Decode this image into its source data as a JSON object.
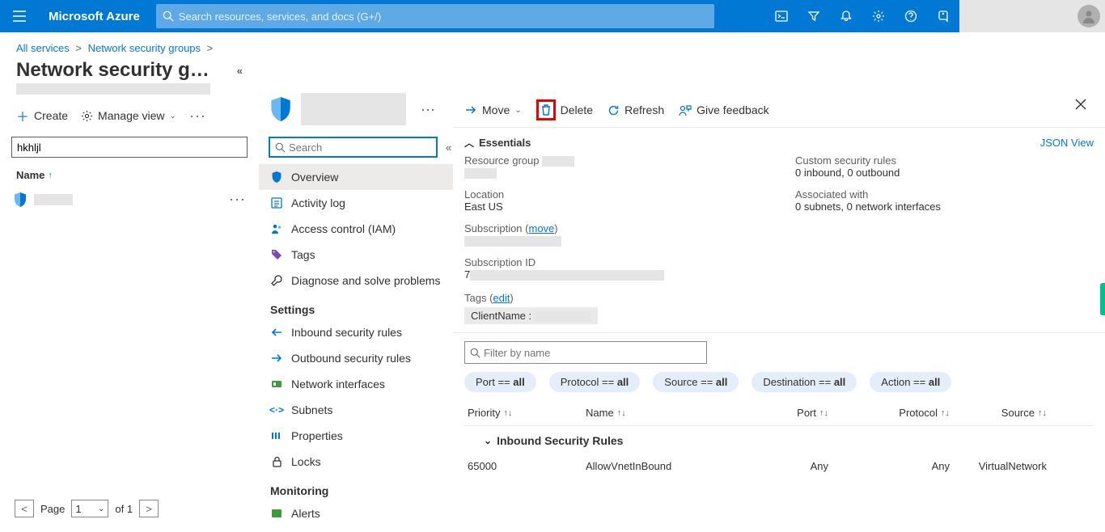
{
  "brand": "Microsoft Azure",
  "search_placeholder": "Search resources, services, and docs (G+/)",
  "breadcrumb": {
    "all_services": "All services",
    "nsg": "Network security groups"
  },
  "left": {
    "title": "Network security g…",
    "create": "Create",
    "manage_view": "Manage view",
    "filter_value": "hkhljl",
    "name_header": "Name",
    "page_label": "Page",
    "page_num": "1",
    "of_label": "of 1"
  },
  "nav": {
    "search_placeholder": "Search",
    "overview": "Overview",
    "activity": "Activity log",
    "iam": "Access control (IAM)",
    "tags": "Tags",
    "diag": "Diagnose and solve problems",
    "grp_settings": "Settings",
    "inbound": "Inbound security rules",
    "outbound": "Outbound security rules",
    "nic": "Network interfaces",
    "subnets": "Subnets",
    "props": "Properties",
    "locks": "Locks",
    "grp_mon": "Monitoring",
    "alerts": "Alerts"
  },
  "cmd": {
    "move": "Move",
    "delete": "Delete",
    "refresh": "Refresh",
    "feedback": "Give feedback"
  },
  "ess": {
    "title": "Essentials",
    "json": "JSON View",
    "rg_lbl": "Resource group",
    "loc_lbl": "Location",
    "loc_val": "East US",
    "sub_lbl": "Subscription",
    "sub_move": "move",
    "subid_lbl": "Subscription ID",
    "subid_val": "7",
    "custom_lbl": "Custom security rules",
    "custom_val": "0 inbound, 0 outbound",
    "assoc_lbl": "Associated with",
    "assoc_val": "0 subnets, 0 network interfaces",
    "tags_lbl": "Tags",
    "tags_edit": "edit",
    "tag_key": "ClientName :"
  },
  "rules": {
    "filter_ph": "Filter by name",
    "pills": {
      "port": "Port == ",
      "port_v": "all",
      "proto": "Protocol == ",
      "proto_v": "all",
      "src": "Source == ",
      "src_v": "all",
      "dst": "Destination == ",
      "dst_v": "all",
      "act": "Action == ",
      "act_v": "all"
    },
    "cols": {
      "priority": "Priority",
      "name": "Name",
      "port": "Port",
      "protocol": "Protocol",
      "source": "Source"
    },
    "group": "Inbound Security Rules",
    "row": {
      "priority": "65000",
      "name": "AllowVnetInBound",
      "port": "Any",
      "protocol": "Any",
      "source": "VirtualNetwork"
    }
  }
}
